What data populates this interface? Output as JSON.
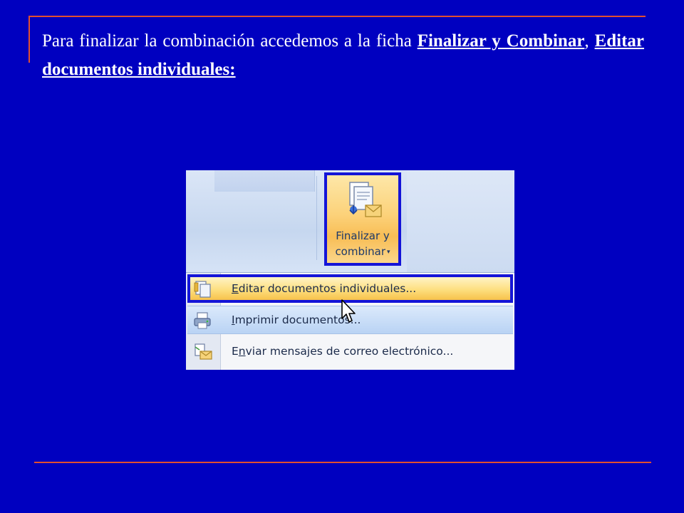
{
  "slide": {
    "text_part1": "Para finalizar la combinación accedemos a la ficha ",
    "link1": "Finalizar y Combinar",
    "separator": ", ",
    "link2": "Editar documentos individuales:"
  },
  "ribbon": {
    "button_label_line1": "Finalizar y",
    "button_label_line2": "combinar",
    "button_icon": "merge-documents-icon",
    "caret": "▾"
  },
  "menu": {
    "items": [
      {
        "underline_char": "E",
        "label_rest": "ditar documentos individuales...",
        "icon": "edit-documents-icon",
        "state": "highlighted"
      },
      {
        "underline_char": "I",
        "label_rest": "mprimir documentos...",
        "icon": "print-documents-icon",
        "state": "hover"
      },
      {
        "underline_char": "",
        "label_pre": "E",
        "label_u": "n",
        "label_rest": "viar mensajes de correo electrónico...",
        "icon": "send-email-icon",
        "state": "normal"
      }
    ]
  },
  "colors": {
    "slide_background": "#0000c0",
    "accent_line": "#e05030",
    "highlight_border": "#1414d8"
  }
}
